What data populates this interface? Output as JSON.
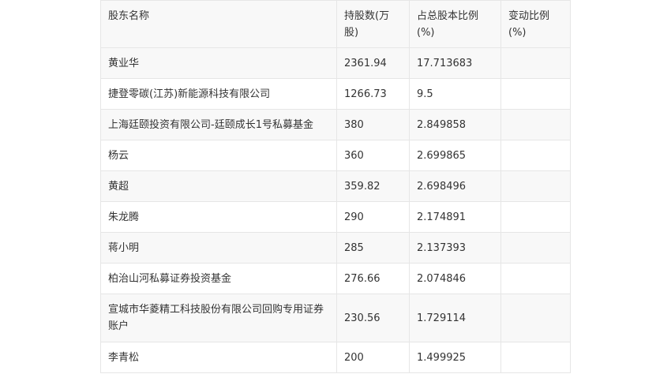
{
  "table": {
    "headers": [
      "股东名称",
      "持股数(万股)",
      "占总股本比例(%)",
      "变动比例(%)"
    ],
    "rows": [
      [
        "黄业华",
        "2361.94",
        "17.713683",
        ""
      ],
      [
        "捷登零碳(江苏)新能源科技有限公司",
        "1266.73",
        "9.5",
        ""
      ],
      [
        "上海廷颐投资有限公司-廷颐成长1号私募基金",
        "380",
        "2.849858",
        ""
      ],
      [
        "杨云",
        "360",
        "2.699865",
        ""
      ],
      [
        "黄超",
        "359.82",
        "2.698496",
        ""
      ],
      [
        "朱龙腾",
        "290",
        "2.174891",
        ""
      ],
      [
        "蒋小明",
        "285",
        "2.137393",
        ""
      ],
      [
        "柏治山河私募证券投资基金",
        "276.66",
        "2.074846",
        ""
      ],
      [
        "宣城市华菱精工科技股份有限公司回购专用证券账户",
        "230.56",
        "1.729114",
        ""
      ],
      [
        "李青松",
        "200",
        "1.499925",
        ""
      ]
    ]
  }
}
